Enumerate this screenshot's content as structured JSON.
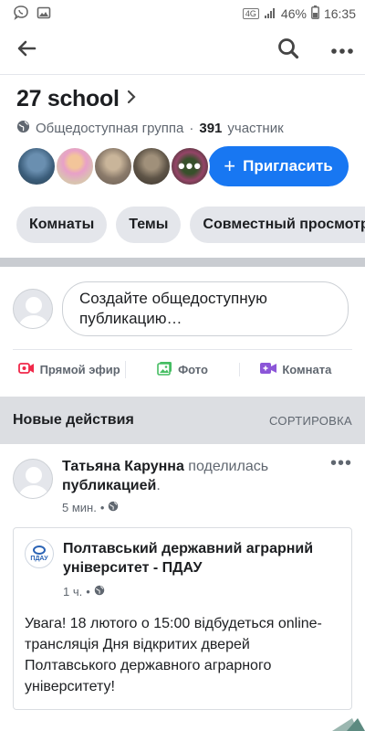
{
  "status": {
    "signal_label": "4G",
    "battery": "46%",
    "time": "16:35"
  },
  "group": {
    "name": "27 school",
    "privacy": "Общедоступная группа",
    "separator": "·",
    "members_count": "391",
    "members_word": "участник",
    "invite_label": "Пригласить",
    "invite_plus": "+",
    "more_avatars": "•••"
  },
  "chips": [
    "Комнаты",
    "Темы",
    "Совместный просмотр"
  ],
  "composer": {
    "placeholder_line1": "Создайте общедоступную",
    "placeholder_line2": "публикацию…"
  },
  "actions": [
    {
      "label": "Прямой эфир",
      "icon": "live-video-icon",
      "color": "#f02849"
    },
    {
      "label": "Фото",
      "icon": "photo-icon",
      "color": "#45bd62"
    },
    {
      "label": "Комната",
      "icon": "room-video-icon",
      "color": "#8c56d8"
    }
  ],
  "feed": {
    "title": "Новые действия",
    "sort_label": "СОРТИРОВКА"
  },
  "post": {
    "author": "Татьяна Карунна",
    "action_text": "поделилась",
    "object": "публикацией",
    "period": ".",
    "time": "5 мин.",
    "dot": "•",
    "more": "•••",
    "shared": {
      "page_name": "Полтавський державний аграрний університет - ПДАУ",
      "logo_text": "ПДАУ",
      "time": "1 ч.",
      "dot": "•",
      "text": "Увага! 18 лютого о 15:00 відбудеться online-трансляція Дня відкритих дверей Полтавського державного аграрного університету!"
    }
  },
  "colors": {
    "accent": "#1877f2",
    "divider": "#c9ccd1",
    "feed_header": "#dcdee2"
  }
}
